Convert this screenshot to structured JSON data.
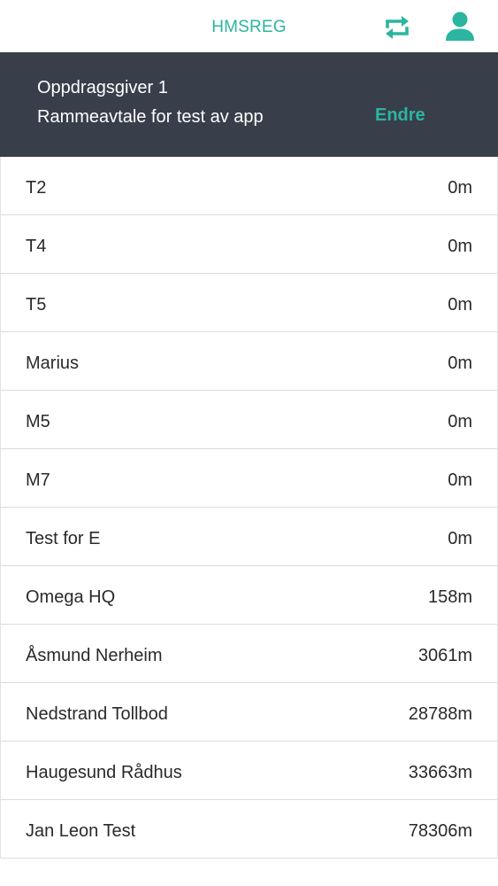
{
  "header": {
    "title": "HMSREG",
    "sync_icon": "sync-arrows-icon",
    "user_icon": "user-icon"
  },
  "context": {
    "client": "Oppdragsgiver 1",
    "agreement": "Rammeavtale for test av app",
    "change_label": "Endre"
  },
  "locations": [
    {
      "name": "T2",
      "distance": "0m"
    },
    {
      "name": "T4",
      "distance": "0m"
    },
    {
      "name": "T5",
      "distance": "0m"
    },
    {
      "name": "Marius",
      "distance": "0m"
    },
    {
      "name": "M5",
      "distance": "0m"
    },
    {
      "name": "M7",
      "distance": "0m"
    },
    {
      "name": "Test for E",
      "distance": "0m"
    },
    {
      "name": "Omega HQ",
      "distance": "158m"
    },
    {
      "name": "Åsmund Nerheim",
      "distance": "3061m"
    },
    {
      "name": "Nedstrand Tollbod",
      "distance": "28788m"
    },
    {
      "name": "Haugesund Rådhus",
      "distance": "33663m"
    },
    {
      "name": "Jan Leon Test",
      "distance": "78306m"
    }
  ],
  "colors": {
    "accent": "#2bb5a0",
    "context_background": "#383f4a",
    "text": "#2a2a2a"
  }
}
